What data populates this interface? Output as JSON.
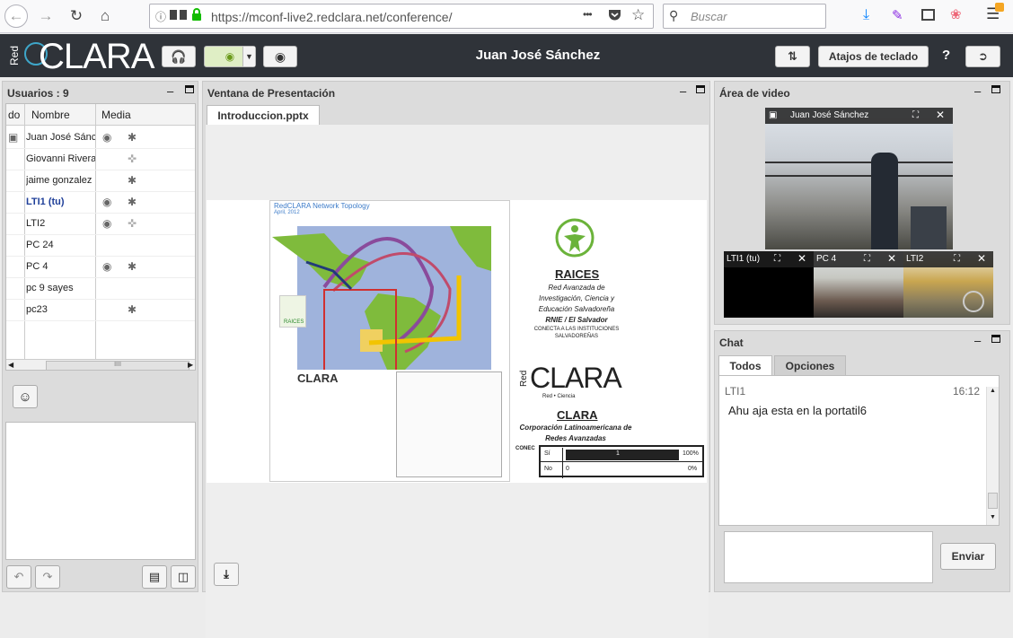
{
  "browser": {
    "url": "https://mconf-live2.redclara.net/conference/",
    "search_placeholder": "Buscar",
    "menu_dots": "•••"
  },
  "header": {
    "logo_text": "CLARA",
    "logo_prefix": "Red",
    "user_name": "Juan José Sánchez",
    "shortcuts_label": "Atajos de teclado",
    "help_label": "?"
  },
  "users_panel": {
    "title": "Usuarios : 9",
    "col_status": "do",
    "col_name": "Nombre",
    "col_media": "Media",
    "scroll_grip": "IIII",
    "users": [
      {
        "name": "Juan José Sánchez",
        "presenter": true,
        "cam": true,
        "audio": "listen"
      },
      {
        "name": "Giovanni Rivera",
        "cam": false,
        "audio": "muted"
      },
      {
        "name": "jaime gonzalez",
        "cam": false,
        "audio": "listen"
      },
      {
        "name": "LTI1 (tu)",
        "me": true,
        "cam": true,
        "audio": "listen"
      },
      {
        "name": "LTI2",
        "cam": true,
        "audio": "muted"
      },
      {
        "name": "PC 24",
        "cam": false,
        "audio": "none"
      },
      {
        "name": "PC 4",
        "cam": true,
        "audio": "listen"
      },
      {
        "name": "pc 9 sayes",
        "cam": false,
        "audio": "none"
      },
      {
        "name": "pc23",
        "cam": false,
        "audio": "listen"
      }
    ]
  },
  "presentation": {
    "title": "Ventana de Presentación",
    "tab_label": "Introduccion.pptx",
    "slide": {
      "map_title": "RedCLARA Network Topology",
      "map_date": "April, 2012",
      "raices_title": "RAICES",
      "raices_sub1": "Red Avanzada de",
      "raices_sub2": "Investigación, Ciencia y",
      "raices_sub3": "Educación Salvadoreña",
      "raices_sub4": "RNIE / El Salvador",
      "raices_sub5": "CONECTA A LAS INSTITUCIONES",
      "raices_sub6": "SALVADOREÑAS",
      "clara_logo": "CLARA",
      "clara_red": "Red",
      "clara_tagline": "Red   •   Ciencia",
      "clara_title": "CLARA",
      "clara_sub1": "Corporación Latinoamericana de",
      "clara_sub2": "Redes Avanzadas",
      "conec_label": "CONEC",
      "map_logo": "CLARA",
      "raices_small": "RAICES",
      "poll": [
        {
          "label": "Sí",
          "count": "1",
          "pct": "100%",
          "fill": 1.0
        },
        {
          "label": "No",
          "count": "0",
          "pct": "0%",
          "fill": 0.0
        }
      ]
    }
  },
  "video": {
    "title": "Área de video",
    "main_name": "Juan José Sánchez",
    "thumbs": [
      {
        "name": "LTI1 (tu)"
      },
      {
        "name": "PC 4"
      },
      {
        "name": "LTI2"
      }
    ]
  },
  "chat": {
    "title": "Chat",
    "tab_all": "Todos",
    "tab_options": "Opciones",
    "messages": [
      {
        "sender": "LTI1",
        "time": "16:12",
        "text": "Ahu aja esta en la portatil6"
      }
    ],
    "send_label": "Enviar"
  },
  "colors": {
    "header_bg": "#2f3339",
    "me_user": "#1f3f99",
    "secure": "#12bc00"
  }
}
